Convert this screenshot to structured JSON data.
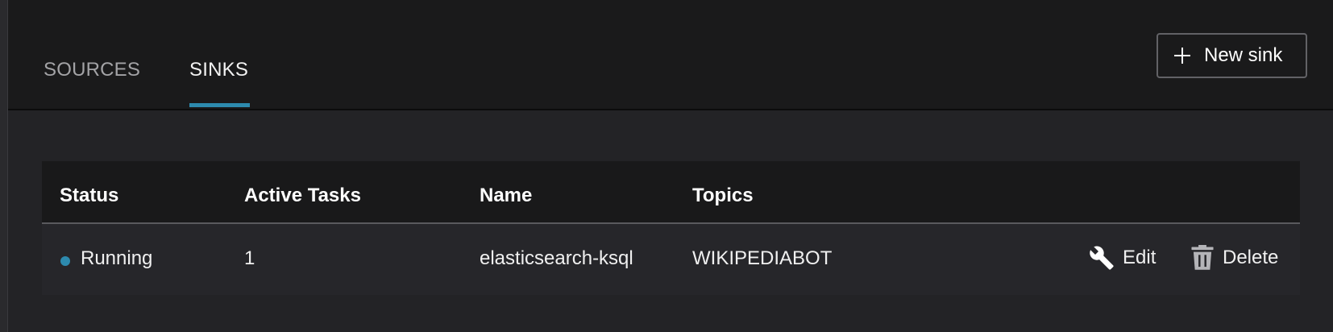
{
  "tabs": [
    {
      "label": "SOURCES"
    },
    {
      "label": "SINKS"
    }
  ],
  "active_tab": "SINKS",
  "toolbar": {
    "new_label": "New sink",
    "new_icon": "plus-icon"
  },
  "table": {
    "columns": [
      "Status",
      "Active Tasks",
      "Name",
      "Topics"
    ],
    "rows": [
      {
        "status": "Running",
        "status_color": "#2d8aae",
        "active_tasks": "1",
        "name": "elasticsearch-ksql",
        "topics": "WIKIPEDIABOT",
        "actions": [
          {
            "label": "Edit",
            "icon": "wrench-icon"
          },
          {
            "label": "Delete",
            "icon": "trash-icon"
          }
        ]
      }
    ]
  },
  "colors": {
    "accent": "#2d8aae",
    "header_bg": "#1a1a1b",
    "page_bg": "#232326"
  }
}
